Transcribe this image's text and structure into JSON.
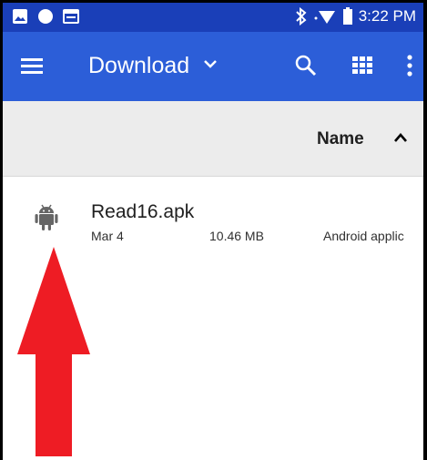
{
  "status_bar": {
    "icons": [
      "image-icon",
      "circle-icon",
      "calendar-icon",
      "bluetooth-icon",
      "wifi-icon",
      "battery-icon"
    ],
    "time": "3:22 PM"
  },
  "toolbar": {
    "menu_icon": "hamburger-menu-icon",
    "title": "Download",
    "title_dropdown_icon": "chevron-down-icon",
    "actions": [
      "search-icon",
      "grid-view-icon",
      "more-vert-icon"
    ]
  },
  "sort_header": {
    "label": "Name",
    "direction_icon": "chevron-up-icon"
  },
  "files": [
    {
      "icon": "android-icon",
      "name": "Read16.apk",
      "date": "Mar 4",
      "size": "10.46 MB",
      "type": "Android applic"
    }
  ],
  "annotation": {
    "icon": "red-up-arrow",
    "color": "#ee1c24"
  },
  "colors": {
    "status_bar": "#1a3fb8",
    "toolbar": "#2c5ed8",
    "sort_bar": "#ececec"
  }
}
